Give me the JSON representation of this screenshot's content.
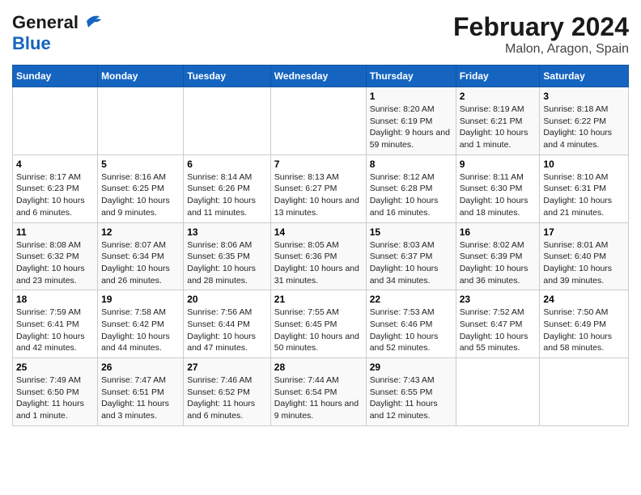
{
  "logo": {
    "line1": "General",
    "line2": "Blue"
  },
  "title": "February 2024",
  "subtitle": "Malon, Aragon, Spain",
  "weekdays": [
    "Sunday",
    "Monday",
    "Tuesday",
    "Wednesday",
    "Thursday",
    "Friday",
    "Saturday"
  ],
  "weeks": [
    [
      {
        "day": "",
        "sunrise": "",
        "sunset": "",
        "daylight": ""
      },
      {
        "day": "",
        "sunrise": "",
        "sunset": "",
        "daylight": ""
      },
      {
        "day": "",
        "sunrise": "",
        "sunset": "",
        "daylight": ""
      },
      {
        "day": "",
        "sunrise": "",
        "sunset": "",
        "daylight": ""
      },
      {
        "day": "1",
        "sunrise": "Sunrise: 8:20 AM",
        "sunset": "Sunset: 6:19 PM",
        "daylight": "Daylight: 9 hours and 59 minutes."
      },
      {
        "day": "2",
        "sunrise": "Sunrise: 8:19 AM",
        "sunset": "Sunset: 6:21 PM",
        "daylight": "Daylight: 10 hours and 1 minute."
      },
      {
        "day": "3",
        "sunrise": "Sunrise: 8:18 AM",
        "sunset": "Sunset: 6:22 PM",
        "daylight": "Daylight: 10 hours and 4 minutes."
      }
    ],
    [
      {
        "day": "4",
        "sunrise": "Sunrise: 8:17 AM",
        "sunset": "Sunset: 6:23 PM",
        "daylight": "Daylight: 10 hours and 6 minutes."
      },
      {
        "day": "5",
        "sunrise": "Sunrise: 8:16 AM",
        "sunset": "Sunset: 6:25 PM",
        "daylight": "Daylight: 10 hours and 9 minutes."
      },
      {
        "day": "6",
        "sunrise": "Sunrise: 8:14 AM",
        "sunset": "Sunset: 6:26 PM",
        "daylight": "Daylight: 10 hours and 11 minutes."
      },
      {
        "day": "7",
        "sunrise": "Sunrise: 8:13 AM",
        "sunset": "Sunset: 6:27 PM",
        "daylight": "Daylight: 10 hours and 13 minutes."
      },
      {
        "day": "8",
        "sunrise": "Sunrise: 8:12 AM",
        "sunset": "Sunset: 6:28 PM",
        "daylight": "Daylight: 10 hours and 16 minutes."
      },
      {
        "day": "9",
        "sunrise": "Sunrise: 8:11 AM",
        "sunset": "Sunset: 6:30 PM",
        "daylight": "Daylight: 10 hours and 18 minutes."
      },
      {
        "day": "10",
        "sunrise": "Sunrise: 8:10 AM",
        "sunset": "Sunset: 6:31 PM",
        "daylight": "Daylight: 10 hours and 21 minutes."
      }
    ],
    [
      {
        "day": "11",
        "sunrise": "Sunrise: 8:08 AM",
        "sunset": "Sunset: 6:32 PM",
        "daylight": "Daylight: 10 hours and 23 minutes."
      },
      {
        "day": "12",
        "sunrise": "Sunrise: 8:07 AM",
        "sunset": "Sunset: 6:34 PM",
        "daylight": "Daylight: 10 hours and 26 minutes."
      },
      {
        "day": "13",
        "sunrise": "Sunrise: 8:06 AM",
        "sunset": "Sunset: 6:35 PM",
        "daylight": "Daylight: 10 hours and 28 minutes."
      },
      {
        "day": "14",
        "sunrise": "Sunrise: 8:05 AM",
        "sunset": "Sunset: 6:36 PM",
        "daylight": "Daylight: 10 hours and 31 minutes."
      },
      {
        "day": "15",
        "sunrise": "Sunrise: 8:03 AM",
        "sunset": "Sunset: 6:37 PM",
        "daylight": "Daylight: 10 hours and 34 minutes."
      },
      {
        "day": "16",
        "sunrise": "Sunrise: 8:02 AM",
        "sunset": "Sunset: 6:39 PM",
        "daylight": "Daylight: 10 hours and 36 minutes."
      },
      {
        "day": "17",
        "sunrise": "Sunrise: 8:01 AM",
        "sunset": "Sunset: 6:40 PM",
        "daylight": "Daylight: 10 hours and 39 minutes."
      }
    ],
    [
      {
        "day": "18",
        "sunrise": "Sunrise: 7:59 AM",
        "sunset": "Sunset: 6:41 PM",
        "daylight": "Daylight: 10 hours and 42 minutes."
      },
      {
        "day": "19",
        "sunrise": "Sunrise: 7:58 AM",
        "sunset": "Sunset: 6:42 PM",
        "daylight": "Daylight: 10 hours and 44 minutes."
      },
      {
        "day": "20",
        "sunrise": "Sunrise: 7:56 AM",
        "sunset": "Sunset: 6:44 PM",
        "daylight": "Daylight: 10 hours and 47 minutes."
      },
      {
        "day": "21",
        "sunrise": "Sunrise: 7:55 AM",
        "sunset": "Sunset: 6:45 PM",
        "daylight": "Daylight: 10 hours and 50 minutes."
      },
      {
        "day": "22",
        "sunrise": "Sunrise: 7:53 AM",
        "sunset": "Sunset: 6:46 PM",
        "daylight": "Daylight: 10 hours and 52 minutes."
      },
      {
        "day": "23",
        "sunrise": "Sunrise: 7:52 AM",
        "sunset": "Sunset: 6:47 PM",
        "daylight": "Daylight: 10 hours and 55 minutes."
      },
      {
        "day": "24",
        "sunrise": "Sunrise: 7:50 AM",
        "sunset": "Sunset: 6:49 PM",
        "daylight": "Daylight: 10 hours and 58 minutes."
      }
    ],
    [
      {
        "day": "25",
        "sunrise": "Sunrise: 7:49 AM",
        "sunset": "Sunset: 6:50 PM",
        "daylight": "Daylight: 11 hours and 1 minute."
      },
      {
        "day": "26",
        "sunrise": "Sunrise: 7:47 AM",
        "sunset": "Sunset: 6:51 PM",
        "daylight": "Daylight: 11 hours and 3 minutes."
      },
      {
        "day": "27",
        "sunrise": "Sunrise: 7:46 AM",
        "sunset": "Sunset: 6:52 PM",
        "daylight": "Daylight: 11 hours and 6 minutes."
      },
      {
        "day": "28",
        "sunrise": "Sunrise: 7:44 AM",
        "sunset": "Sunset: 6:54 PM",
        "daylight": "Daylight: 11 hours and 9 minutes."
      },
      {
        "day": "29",
        "sunrise": "Sunrise: 7:43 AM",
        "sunset": "Sunset: 6:55 PM",
        "daylight": "Daylight: 11 hours and 12 minutes."
      },
      {
        "day": "",
        "sunrise": "",
        "sunset": "",
        "daylight": ""
      },
      {
        "day": "",
        "sunrise": "",
        "sunset": "",
        "daylight": ""
      }
    ]
  ]
}
